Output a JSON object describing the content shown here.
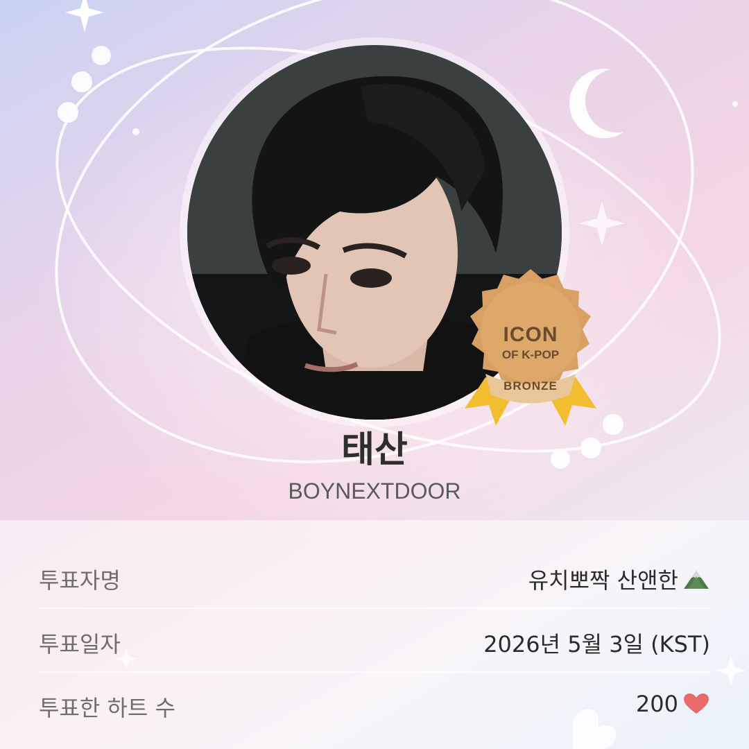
{
  "header": {
    "title_fragment": ""
  },
  "artist": {
    "name": "태산",
    "group": "BOYNEXTDOOR"
  },
  "badge": {
    "line1": "ICON",
    "line2": "OF K-POP",
    "tier": "BRONZE",
    "coin_color": "#d9a063",
    "ribbon_color": "#f2bd2e"
  },
  "info": {
    "rows": [
      {
        "label": "투표자명",
        "value": "유치뽀짝 산앤한",
        "icon": "mountain-emoji-icon"
      },
      {
        "label": "투표일자",
        "value": "2026년 5월 3일 (KST)"
      },
      {
        "label": "투표한 하트 수",
        "value": "200",
        "icon": "heart-icon"
      }
    ]
  },
  "colors": {
    "heart": "#e86a6a",
    "accent_text": "#2b2b2b"
  }
}
